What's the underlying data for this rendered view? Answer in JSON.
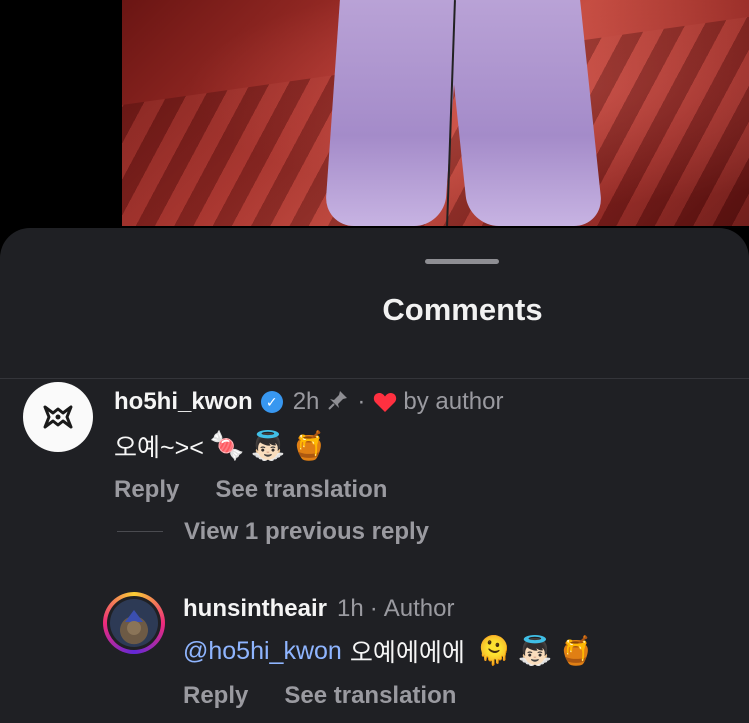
{
  "header": {
    "title": "Comments"
  },
  "comments": [
    {
      "username": "ho5hi_kwon",
      "time": "2h",
      "separator": "·",
      "liked_by": "by author",
      "text": "오예~><",
      "emojis": [
        "🍬",
        "👼🏻",
        "🍯"
      ],
      "actions": {
        "reply": "Reply",
        "translate": "See translation"
      },
      "view_replies": "View 1 previous reply"
    },
    {
      "username": "hunsintheair",
      "time": "1h",
      "separator": "·",
      "badge": "Author",
      "mention": "@ho5hi_kwon",
      "text": "오예에에에",
      "emojis": [
        "🫠",
        "👼🏻",
        "🍯"
      ],
      "actions": {
        "reply": "Reply",
        "translate": "See translation"
      }
    }
  ],
  "colors": {
    "sheet_bg": "#1f2024",
    "accent_like": "#ff3040",
    "verified": "#3897f0",
    "mention": "#8fb5ff"
  }
}
